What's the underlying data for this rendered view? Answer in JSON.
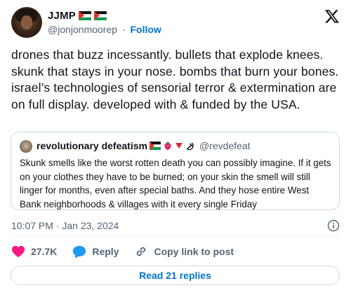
{
  "author": {
    "name": "JJMP",
    "handle": "@jonjonmoorep",
    "separator": "·",
    "follow_label": "Follow"
  },
  "tweet": {
    "text": "drones that buzz incessantly. bullets that explode knees. skunk that stays in your nose. bombs that burn your bones. israel’s technologies of sensorial terror & extermination are on full display. developed with & funded by the USA."
  },
  "quoted": {
    "name": "revolutionary defeatism",
    "handle": "@revdefeat",
    "text": "Skunk smells like the worst rotten death you can possibly imagine. If it gets on your clothes they have to be burned; on your skin the smell will still linger for months, even after special baths. And they hose entire West Bank neighborhoods & villages with it every single Friday"
  },
  "meta": {
    "timestamp": "10:07 PM · Jan 23, 2024"
  },
  "actions": {
    "like_count": "27.7K",
    "reply_label": "Reply",
    "copy_label": "Copy link to post"
  },
  "footer": {
    "read_replies_label": "Read 21 replies"
  },
  "colors": {
    "link_blue": "#0074cc",
    "heart_red": "#f91880",
    "reply_blue": "#1d9bf0",
    "muted": "#536471"
  },
  "icons": [
    "palestine-flag-icon",
    "x-logo-icon",
    "strawberry-icon",
    "triangle-icon",
    "hammer-sickle-icon",
    "info-icon",
    "heart-icon",
    "reply-bubble-icon",
    "link-icon"
  ]
}
